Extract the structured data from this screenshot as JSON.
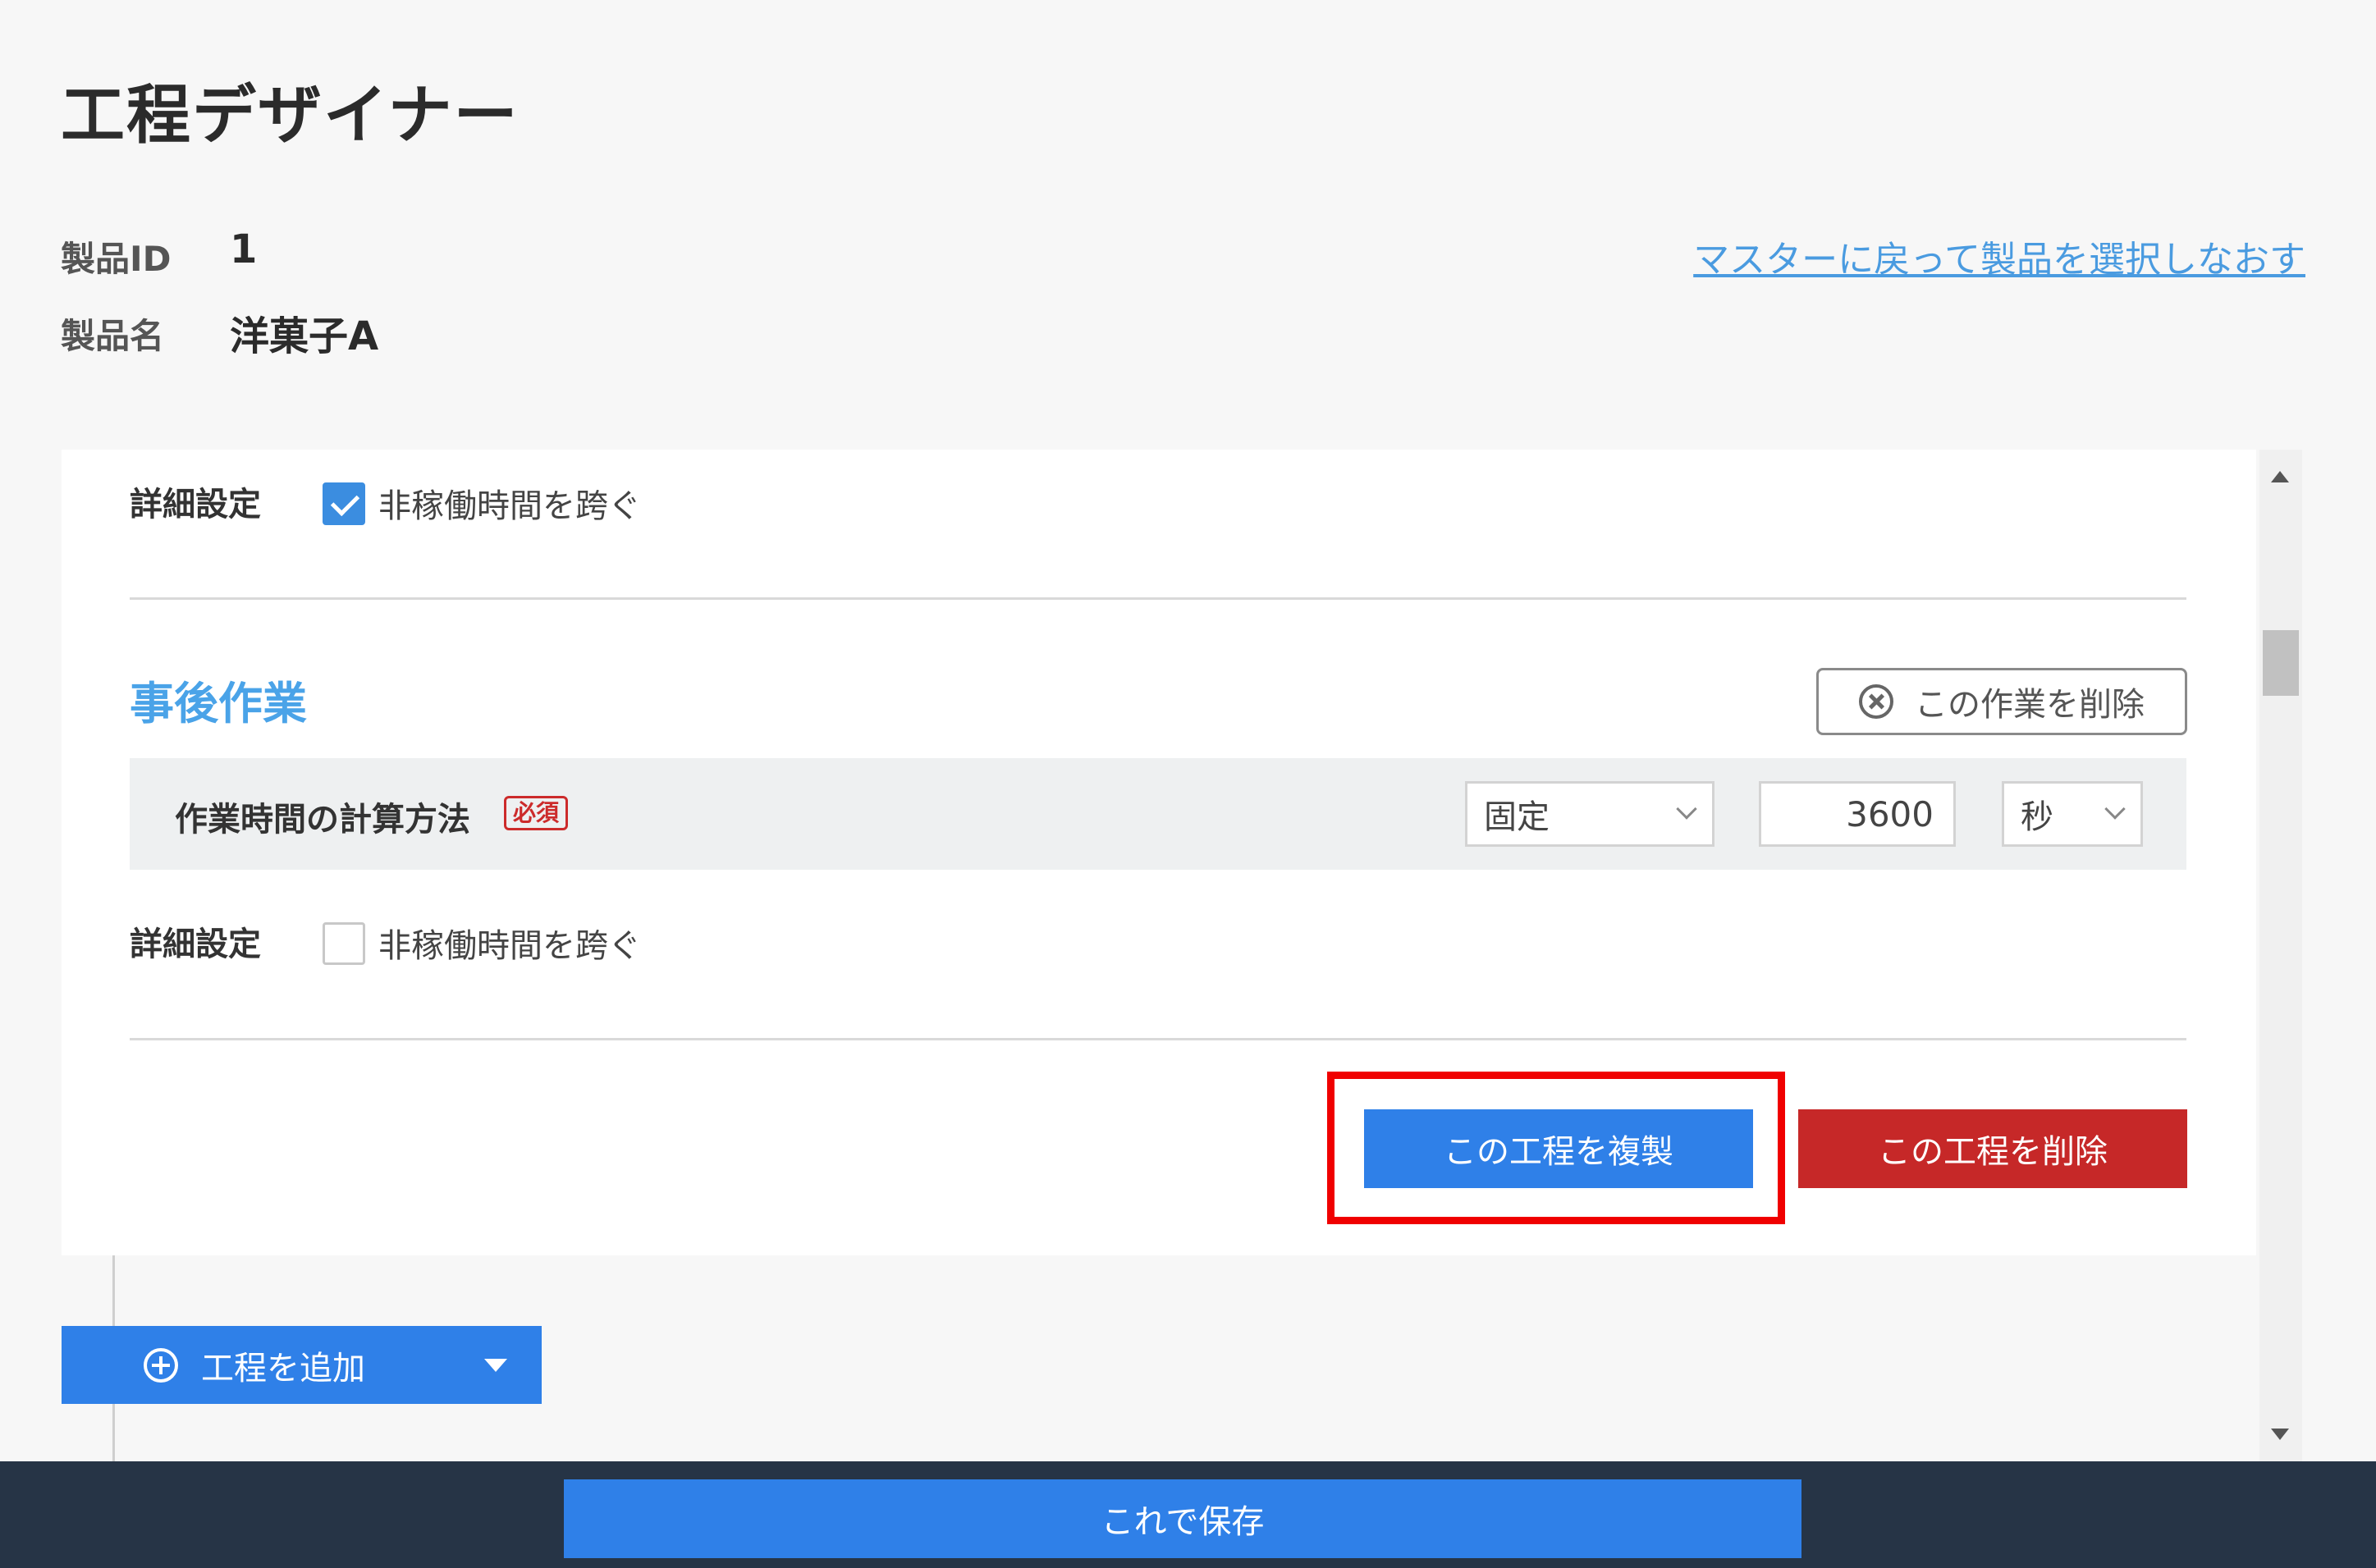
{
  "header": {
    "title": "工程デザイナー",
    "product_id_label": "製品ID",
    "product_id_value": "1",
    "product_name_label": "製品名",
    "product_name_value": "洋菓子A",
    "back_link": "マスターに戻って製品を選択しなおす"
  },
  "step_card": {
    "advanced_settings_label_1": "詳細設定",
    "cross_nonworking_1": {
      "label": "非稼働時間を跨ぐ",
      "checked": true
    },
    "post_task_title": "事後作業",
    "delete_task_button": "この作業を削除",
    "calc_method_label": "作業時間の計算方法",
    "required_badge": "必須",
    "calc_method_value": "固定",
    "duration_value": "3600",
    "unit_value": "秒",
    "advanced_settings_label_2": "詳細設定",
    "cross_nonworking_2": {
      "label": "非稼働時間を跨ぐ",
      "checked": false
    },
    "duplicate_step_button": "この工程を複製",
    "delete_step_button": "この工程を削除"
  },
  "add_step_button": "工程を追加",
  "footer": {
    "save_button": "これで保存"
  },
  "colors": {
    "accent_blue": "#2f80e8",
    "danger_red": "#c62828",
    "section_title": "#4aa3e8",
    "highlight": "#f00000",
    "footer_bg": "#263446"
  }
}
